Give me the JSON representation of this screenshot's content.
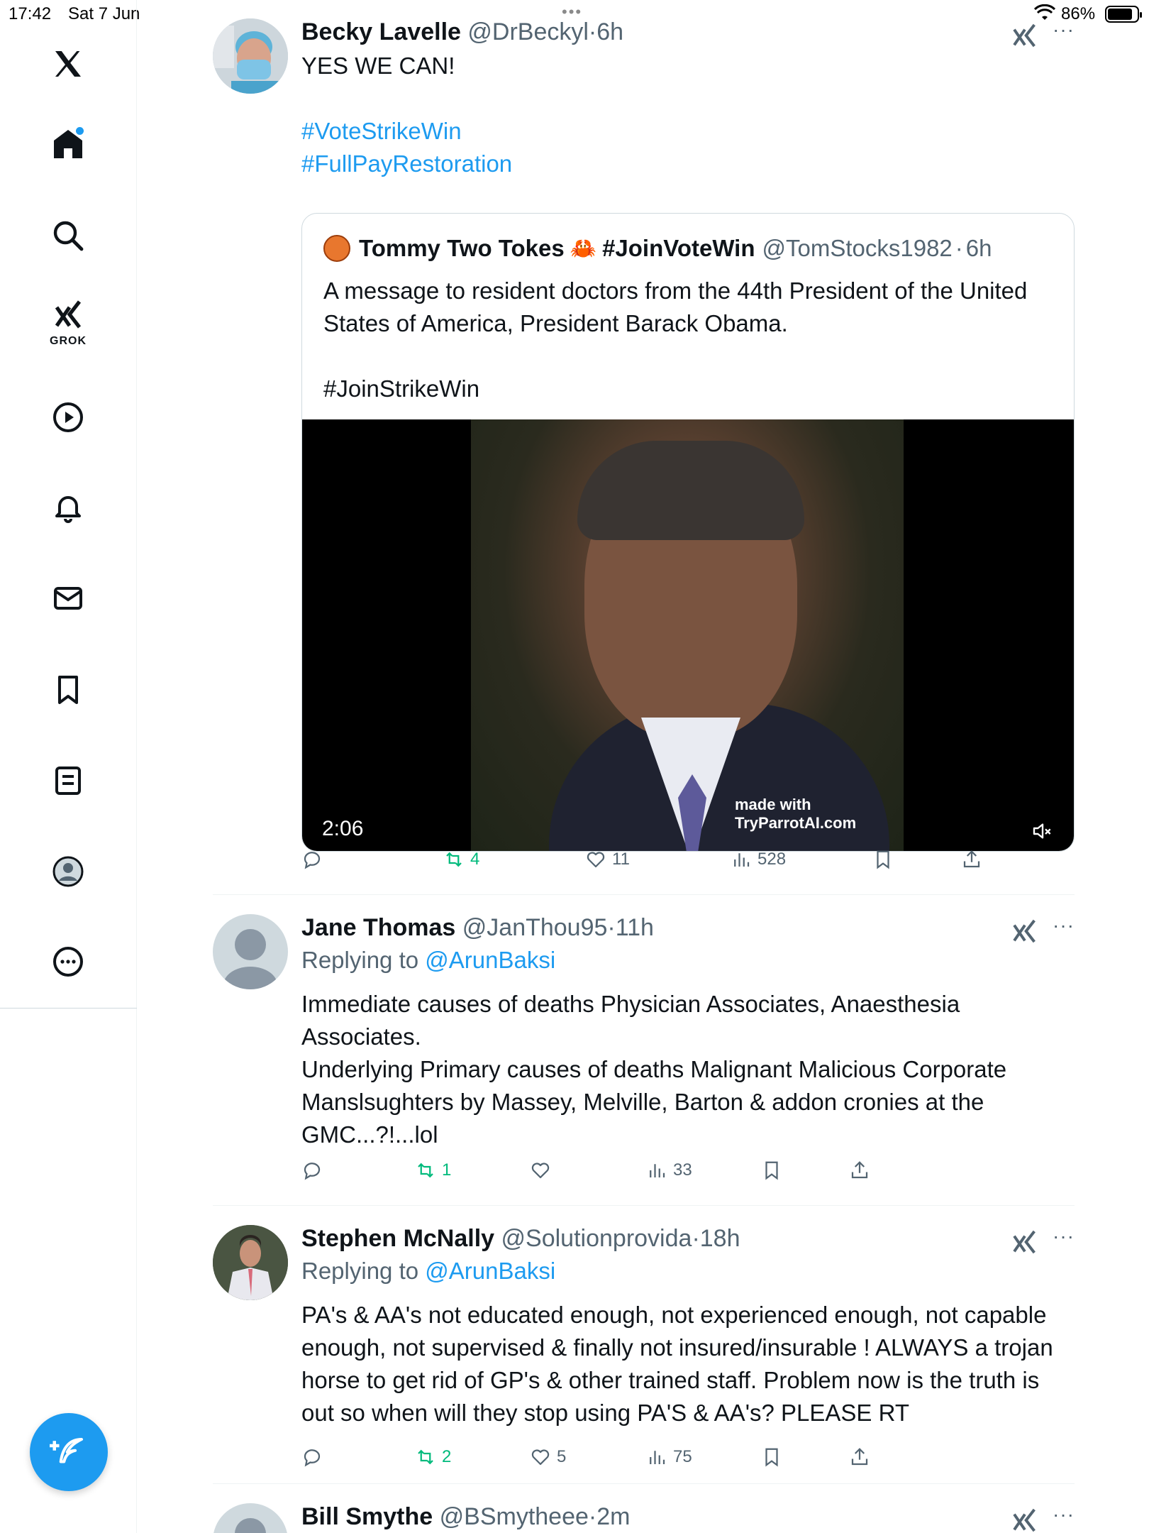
{
  "status_bar": {
    "time": "17:42",
    "date": "Sat 7 Jun",
    "battery": "86%",
    "battery_level": 0.86
  },
  "sidebar": {
    "items": [
      {
        "name": "x-logo-icon"
      },
      {
        "name": "home-icon"
      },
      {
        "name": "search-icon"
      },
      {
        "name": "grok-icon",
        "label": "GROK"
      },
      {
        "name": "video-icon"
      },
      {
        "name": "notifications-icon"
      },
      {
        "name": "messages-icon"
      },
      {
        "name": "bookmarks-icon"
      },
      {
        "name": "lists-icon"
      },
      {
        "name": "profile-icon"
      },
      {
        "name": "more-icon"
      }
    ]
  },
  "posts": [
    {
      "name": "Becky Lavelle",
      "handle": "@DrBeckyl",
      "time": "6h",
      "text_line1": "YES WE CAN!",
      "hashtag1": "#VoteStrikeWin",
      "hashtag2": "#FullPayRestoration",
      "quote": {
        "name": "Tommy Two Tokes",
        "crab": "🦀",
        "tag": "#JoinVoteWin",
        "handle": "@TomStocks1982",
        "time": "6h",
        "text": "A message to resident doctors from the 44th President of the United States of America, President Barack Obama.",
        "hashtag": "#JoinStrikeWin",
        "video_duration": "2:06",
        "watermark_line1": "made with",
        "watermark_line2": "TryParrotAI.com"
      },
      "reposts": "4",
      "likes": "11",
      "views": "528"
    },
    {
      "name": "Jane Thomas",
      "handle": "@JanThou95",
      "time": "11h",
      "replying_prefix": "Replying to ",
      "replying_to": "@ArunBaksi",
      "text": "Immediate causes of deaths Physician Associates, Anaesthesia Associates.\nUnderlying Primary causes of deaths Malignant Malicious Corporate Manslsughters by Massey, Melville, Barton & addon cronies at the GMC...?!...lol",
      "reposts": "1",
      "likes": "",
      "views": "33"
    },
    {
      "name": "Stephen McNally",
      "handle": "@Solutionprovida",
      "time": "18h",
      "replying_prefix": "Replying to ",
      "replying_to": "@ArunBaksi",
      "text": "PA's & AA's not educated enough, not experienced enough, not capable enough, not supervised & finally not insured/insurable ! ALWAYS a trojan horse to get rid of GP's & other trained staff. Problem now is the truth is out so when will they stop using PA'S & AA's? PLEASE RT",
      "reposts": "2",
      "likes": "5",
      "views": "75"
    },
    {
      "name": "Bill Smythe",
      "handle": "@BSmytheee",
      "time": "2m"
    }
  ],
  "colors": {
    "accent": "#1d9bf0",
    "repost": "#00ba7c",
    "muted": "#536471"
  }
}
